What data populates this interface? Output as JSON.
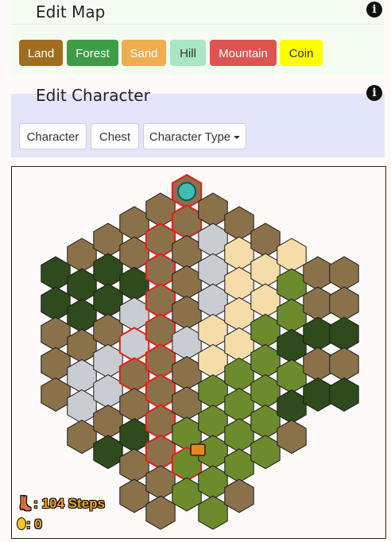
{
  "edit_map": {
    "title": "Edit Map",
    "buttons": [
      {
        "label": "Land",
        "color": "#a06d1e",
        "text_color": "#ffffff"
      },
      {
        "label": "Forest",
        "color": "#3f9c46",
        "text_color": "#ffffff"
      },
      {
        "label": "Sand",
        "color": "#f0ad4e",
        "text_color": "#ffffff"
      },
      {
        "label": "Hill",
        "color": "#a8e6c4",
        "text_color": "#333333"
      },
      {
        "label": "Mountain",
        "color": "#dd5453",
        "text_color": "#ffffff"
      },
      {
        "label": "Coin",
        "color": "#ffff00",
        "text_color": "#333333"
      }
    ]
  },
  "edit_character": {
    "title": "Edit Character",
    "buttons": {
      "character": "Character",
      "chest": "Chest",
      "character_type": "Character Type"
    }
  },
  "info_icon_glyph": "i",
  "stats": {
    "steps": "104 Steps",
    "coins": "0",
    "separator": ":"
  },
  "terrain_colors": {
    "land": "#8b7149",
    "forest": "#2f4a1c",
    "grass": "#6c8b2d",
    "sand": "#f6dca8",
    "mountain": "#c9cdd2"
  },
  "hex_map": {
    "rows": [
      "ccccccccLccccccccccc",
      "ccccccLLLLLccccc",
      "cccccLLLLLLLccccc",
      "ccLLLLLMLLLSccc",
      "cFLLLLMLGGLSL",
      "FFFFLLMMLSGGL",
      "FFFLLMLLSGLFL",
      "LLMLLSSGGFL",
      "LMMLFSSGLGF",
      "LMLLLLGGGFF",
      "LLLLLGGGFFL",
      "LFFLLGGGFGL",
      "LFLLGGGGGF",
      "LLGGGGGGL",
      "LLGGGGL",
      "LGL",
      "L"
    ]
  }
}
